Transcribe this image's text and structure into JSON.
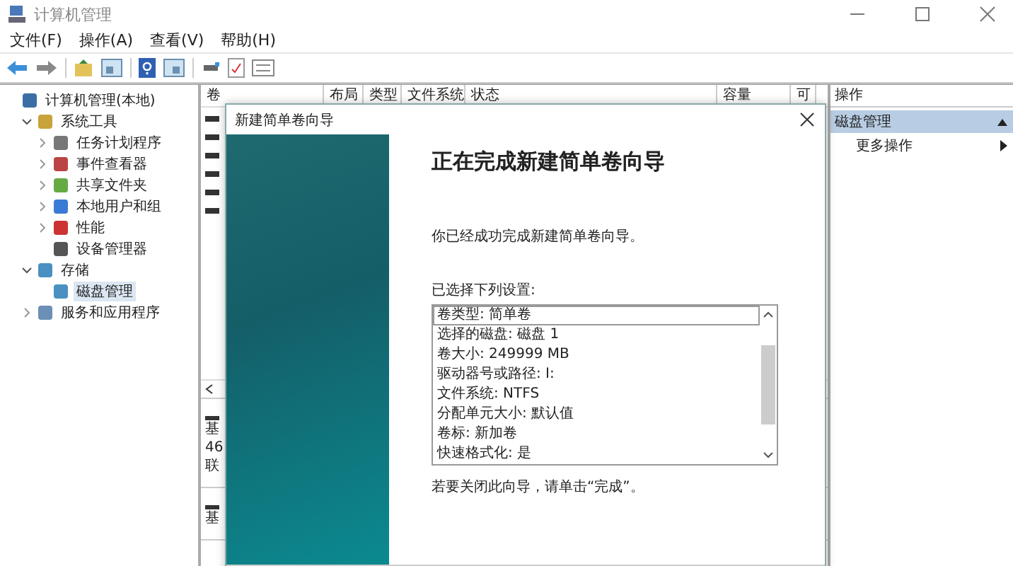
{
  "window": {
    "title": "计算机管理"
  },
  "menu": [
    "文件(F)",
    "操作(A)",
    "查看(V)",
    "帮助(H)"
  ],
  "tree": [
    {
      "label": "计算机管理(本地)",
      "selected": false,
      "children": [
        {
          "label": "系统工具",
          "expanded": true,
          "selected": false,
          "children": [
            {
              "label": "任务计划程序",
              "expanded": false,
              "selected": false
            },
            {
              "label": "事件查看器",
              "expanded": false,
              "selected": false
            },
            {
              "label": "共享文件夹",
              "expanded": false,
              "selected": false
            },
            {
              "label": "本地用户和组",
              "expanded": false,
              "selected": false
            },
            {
              "label": "性能",
              "expanded": false,
              "selected": false
            },
            {
              "label": "设备管理器",
              "selected": false
            }
          ]
        },
        {
          "label": "存储",
          "expanded": true,
          "selected": false,
          "children": [
            {
              "label": "磁盘管理",
              "selected": true
            }
          ]
        },
        {
          "label": "服务和应用程序",
          "expanded": false,
          "selected": false
        }
      ]
    }
  ],
  "volume_table": {
    "columns": [
      "卷",
      "布局",
      "类型",
      "文件系统",
      "状态",
      "容量",
      "可"
    ]
  },
  "disks": [
    {
      "lines": [
        "基",
        "46",
        "联"
      ]
    },
    {
      "lines": [
        "基"
      ]
    }
  ],
  "dialog": {
    "title": "新建简单卷向导",
    "heading": "正在完成新建简单卷向导",
    "intro": "你已经成功完成新建简单卷向导。",
    "settings_label": "已选择下列设置:",
    "settings": [
      {
        "text": "卷类型: 简单卷",
        "selected": true
      },
      {
        "text": "选择的磁盘: 磁盘 1",
        "selected": false
      },
      {
        "text": "卷大小: 249999 MB",
        "selected": false
      },
      {
        "text": "驱动器号或路径: I:",
        "selected": false
      },
      {
        "text": "文件系统: NTFS",
        "selected": false
      },
      {
        "text": "分配单元大小: 默认值",
        "selected": false
      },
      {
        "text": "卷标: 新加卷",
        "selected": false
      },
      {
        "text": "快速格式化: 是",
        "selected": false
      }
    ],
    "footer": "若要关闭此向导，请单击“完成”。"
  },
  "actions": {
    "title": "操作",
    "sections": [
      {
        "label": "磁盘管理",
        "expanded": true,
        "items": [
          {
            "label": "更多操作"
          }
        ]
      }
    ]
  }
}
